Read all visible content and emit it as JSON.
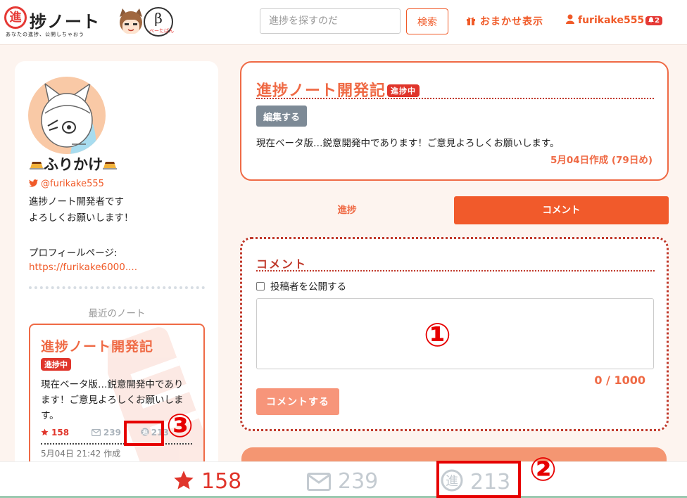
{
  "header": {
    "logo_mark": "進",
    "logo_title": "捗ノート",
    "logo_subtitle": "あなたの進捗、公開しちゃおう",
    "beta_letter": "β",
    "beta_text": "べーたばん",
    "search_placeholder": "進捗を探すのだ",
    "search_button": "検索",
    "random_label": "おまかせ表示",
    "username": "furikake555",
    "notification_count": "2"
  },
  "profile": {
    "name": "ふりかけ",
    "twitter": "@furikake555",
    "bio_line1": "進捗ノート開発者です",
    "bio_line2": "よろしくお願いします！",
    "profile_page_label": "プロフィールページ:",
    "profile_url": "https://furikake6000....",
    "recent_notes_label": "最近のノート"
  },
  "recent_note": {
    "title": "進捗ノート開発記",
    "status": "進捗中",
    "description": "現在ベータ版…鋭意開発中であります！ご意見よろしくお願いします。",
    "stars": "158",
    "comments": "239",
    "progress": "213",
    "date": "5月04日 21:42 作成"
  },
  "note": {
    "title": "進捗ノート開発記",
    "status": "進捗中",
    "edit_button": "編集する",
    "description": "現在ベータ版…鋭意開発中であります！ご意見よろしくお願いします。",
    "created": "5月04日作成 (79日め)"
  },
  "tabs": {
    "progress": "進捗",
    "comment": "コメント"
  },
  "comment_form": {
    "heading": "コメント",
    "checkbox_label": "投稿者を公開する",
    "char_count": "0 / 1000",
    "submit_button": "コメントする"
  },
  "bottom_bar": {
    "stars": "158",
    "comments": "239",
    "progress": "213"
  },
  "annotations": {
    "marker_1": "①",
    "marker_2": "②",
    "marker_3": "③"
  },
  "colors": {
    "accent": "#f05a28",
    "status_badge": "#e0352b",
    "annotation_red": "#e60000"
  }
}
